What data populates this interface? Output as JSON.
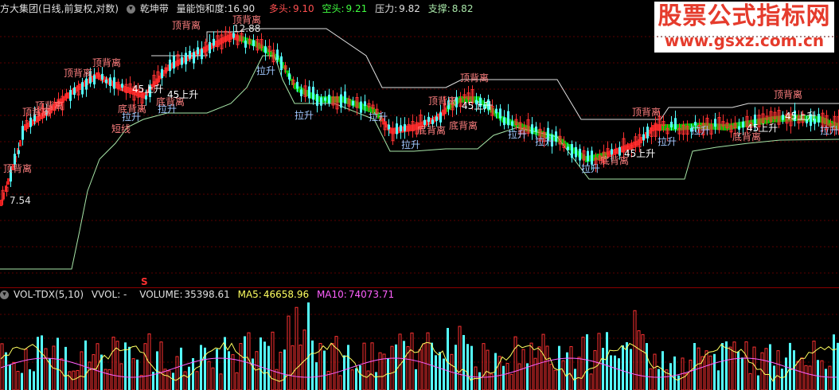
{
  "header": {
    "stock_name": "方大集团(日线,前复权,对数)",
    "indicator_name": "乾坤带",
    "energy_label": "量能饱和度:",
    "energy_value": "16.90",
    "long_label": "多头:",
    "long_value": "9.10",
    "short_label": "空头:",
    "short_value": "9.21",
    "pressure_label": "压力:",
    "pressure_value": "9.82",
    "support_label": "支撑:",
    "support_value": "8.82"
  },
  "volume_header": {
    "indicator": "VOL-TDX(5,10)",
    "vvol": "VVOL: -",
    "volume_label": "VOLUME:",
    "volume_value": "35398.61",
    "ma5_label": "MA5:",
    "ma5_value": "46658.96",
    "ma10_label": "MA10:",
    "ma10_value": "74073.71"
  },
  "watermark": {
    "title": "股票公式指标网",
    "url": "www.gsxz.com.cn"
  },
  "price_labels": {
    "high": "12.88",
    "low": "7.54"
  },
  "marker_s": "S",
  "annotations": {
    "top_divergence": "顶背离",
    "bottom_divergence": "底背离",
    "pull_up": "拉升",
    "rise_45": "45上升",
    "short_line": "短线"
  },
  "colors": {
    "up": "#ff3232",
    "down": "#54ffff",
    "band_green": "#00d000",
    "band_red": "#ff2020",
    "support_line": "#a8e6a8",
    "pressure_line": "#e0e0e0",
    "ma5": "#ffff60",
    "ma10": "#ff60ff"
  }
}
